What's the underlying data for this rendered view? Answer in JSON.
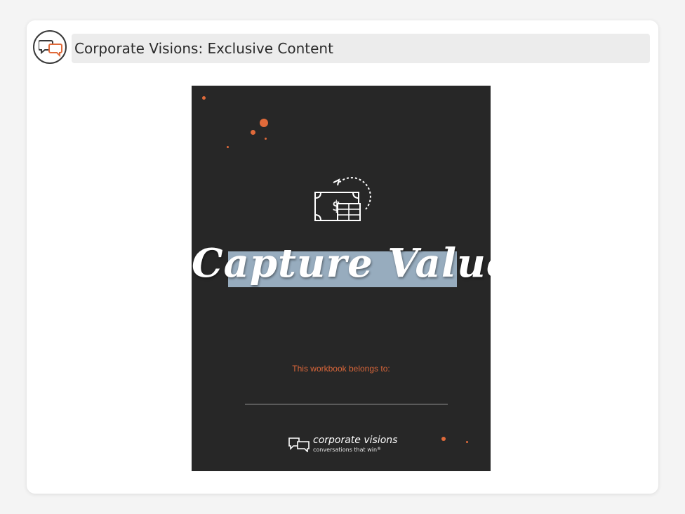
{
  "header": {
    "title": "Corporate Visions: Exclusive Content",
    "logo_icon": "chat-bubbles-icon"
  },
  "cover": {
    "title": "Capture Value",
    "belongs_label": "This workbook belongs to:",
    "icon": "money-exchange-icon",
    "brand_name": "corporate visions",
    "brand_tagline": "conversations that win",
    "brand_tagline_mark": "®"
  },
  "colors": {
    "accent": "#e06a3a",
    "cover_bg": "#272727",
    "title_band": "#97acbe"
  }
}
